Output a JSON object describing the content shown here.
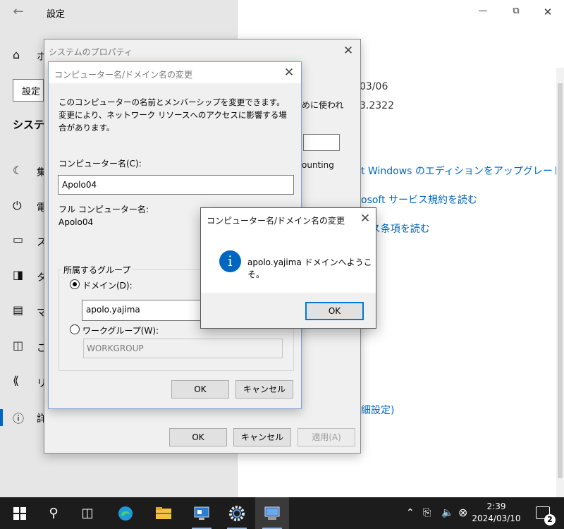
{
  "settings": {
    "title": "設定",
    "back_icon": "back-arrow-icon",
    "home_label_partial": "ホ",
    "search_partial": "設定",
    "section_title_partial": "システム",
    "nav_partials": [
      "集",
      "電",
      "ス",
      "タ",
      "マ",
      "こ",
      "リ",
      "詳"
    ],
    "right": {
      "date_partial": "03/06",
      "used_partial": "めに使われ",
      "version_partial": "3.2322",
      "accounting_partial": "ounting",
      "link_upgrade": "t Windows のエディションをアップグレード",
      "link_service": "osoft サービス規約を読む",
      "link_license": "ンス条項を読む",
      "link_advanced": "細設定)"
    }
  },
  "system_properties": {
    "title": "システムのプロパティ",
    "ok": "OK",
    "cancel": "キャンセル",
    "apply": "適用(A)"
  },
  "computer_name_dialog": {
    "title": "コンピューター名/ドメイン名の変更",
    "description": "このコンピューターの名前とメンバーシップを変更できます。変更により、ネットワーク リソースへのアクセスに影響する場合があります。",
    "computer_name_label": "コンピューター名(C):",
    "computer_name_value": "Apolo04",
    "full_name_label": "フル コンピューター名:",
    "full_name_value": "Apolo04",
    "member_of_label": "所属するグループ",
    "domain_radio_label": "ドメイン(D):",
    "domain_value": "apolo.yajima",
    "workgroup_radio_label": "ワークグループ(W):",
    "workgroup_value": "WORKGROUP",
    "ok": "OK",
    "cancel": "キャンセル"
  },
  "message_box": {
    "title": "コンピューター名/ドメイン名の変更",
    "icon": "info-icon",
    "message": "apolo.yajima ドメインへようこそ。",
    "ok": "OK"
  },
  "taskbar": {
    "time": "2:39",
    "date": "2024/03/10",
    "notification_count": "2",
    "pinned": [
      "start-icon",
      "search-icon",
      "task-view-icon",
      "edge-icon",
      "file-explorer-icon",
      "control-panel-icon",
      "settings-icon",
      "system-properties-icon"
    ]
  }
}
